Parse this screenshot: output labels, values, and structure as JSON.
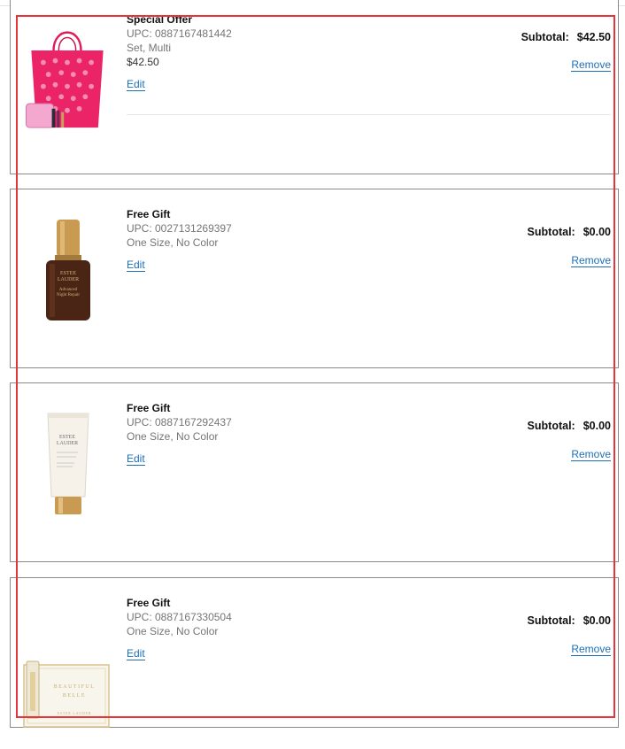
{
  "items": [
    {
      "title": "Special Offer",
      "upc": "UPC: 0887167481442",
      "variant": "Set, Multi",
      "price": "$42.50",
      "edit_label": "Edit",
      "subtotal_label": "Subtotal:",
      "subtotal_value": "$42.50",
      "remove_label": "Remove",
      "image": "pink-tote-bag-gift-set"
    },
    {
      "title": "Free Gift",
      "upc": "UPC: 0027131269397",
      "variant": "One Size, No Color",
      "edit_label": "Edit",
      "subtotal_label": "Subtotal:",
      "subtotal_value": "$0.00",
      "remove_label": "Remove",
      "image": "serum-bottle",
      "image_text": [
        "ESTEE",
        "LAUDER",
        "Advanced",
        "Night Repair"
      ]
    },
    {
      "title": "Free Gift",
      "upc": "UPC: 0887167292437",
      "variant": "One Size, No Color",
      "edit_label": "Edit",
      "subtotal_label": "Subtotal:",
      "subtotal_value": "$0.00",
      "remove_label": "Remove",
      "image": "cream-tube",
      "image_text": [
        "ESTEE",
        "LAUDER"
      ]
    },
    {
      "title": "Free Gift",
      "upc": "UPC: 0887167330504",
      "variant": "One Size, No Color",
      "edit_label": "Edit",
      "subtotal_label": "Subtotal:",
      "subtotal_value": "$0.00",
      "remove_label": "Remove",
      "image": "fragrance-box",
      "image_text": [
        "BEAUTIFUL",
        "BELLE",
        "ESTEE LAUDER"
      ]
    }
  ],
  "colors": {
    "link": "#1d6fb8",
    "highlight": "#e5343a",
    "border": "#8a8a8a"
  }
}
